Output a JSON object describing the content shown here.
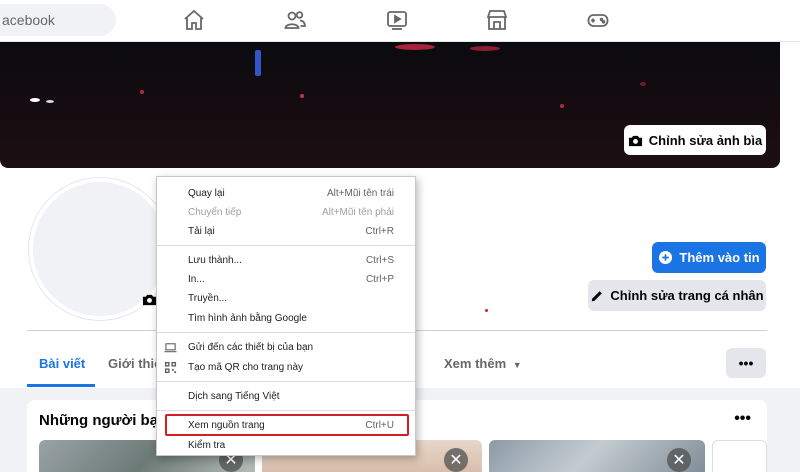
{
  "topbar": {
    "search_text": "acebook",
    "nav_icons": [
      "home-icon",
      "friends-icon",
      "watch-icon",
      "marketplace-icon",
      "gaming-icon"
    ]
  },
  "cover": {
    "edit_label": "Chỉnh sửa ảnh bìa"
  },
  "profile": {
    "add_story_label": "Thêm vào tin",
    "edit_profile_label": "Chỉnh sửa trang cá nhân"
  },
  "tabs": {
    "posts": "Bài viết",
    "about": "Giới thiệ",
    "more": "Xem thêm",
    "more_button": "•••"
  },
  "friends_card": {
    "title": "Những người bạn",
    "dots": "•••",
    "close": "✕"
  },
  "context_menu": {
    "items": [
      {
        "label": "Quay lại",
        "shortcut": "Alt+Mũi tên trái"
      },
      {
        "label": "Chuyển tiếp",
        "shortcut": "Alt+Mũi tên phải"
      },
      {
        "label": "Tải lại",
        "shortcut": "Ctrl+R"
      },
      {
        "label": "Lưu thành...",
        "shortcut": "Ctrl+S"
      },
      {
        "label": "In...",
        "shortcut": "Ctrl+P"
      },
      {
        "label": "Truyền...",
        "shortcut": ""
      },
      {
        "label": "Tìm hình ảnh bằng Google",
        "shortcut": ""
      },
      {
        "label": "Gửi đến các thiết bị của bạn",
        "shortcut": ""
      },
      {
        "label": "Tạo mã QR cho trang này",
        "shortcut": ""
      },
      {
        "label": "Dịch sang Tiếng Việt",
        "shortcut": ""
      },
      {
        "label": "Xem nguồn trang",
        "shortcut": "Ctrl+U"
      },
      {
        "label": "Kiểm tra",
        "shortcut": ""
      }
    ]
  },
  "colors": {
    "accent": "#1b74e4",
    "highlight_border": "#d41d24"
  }
}
